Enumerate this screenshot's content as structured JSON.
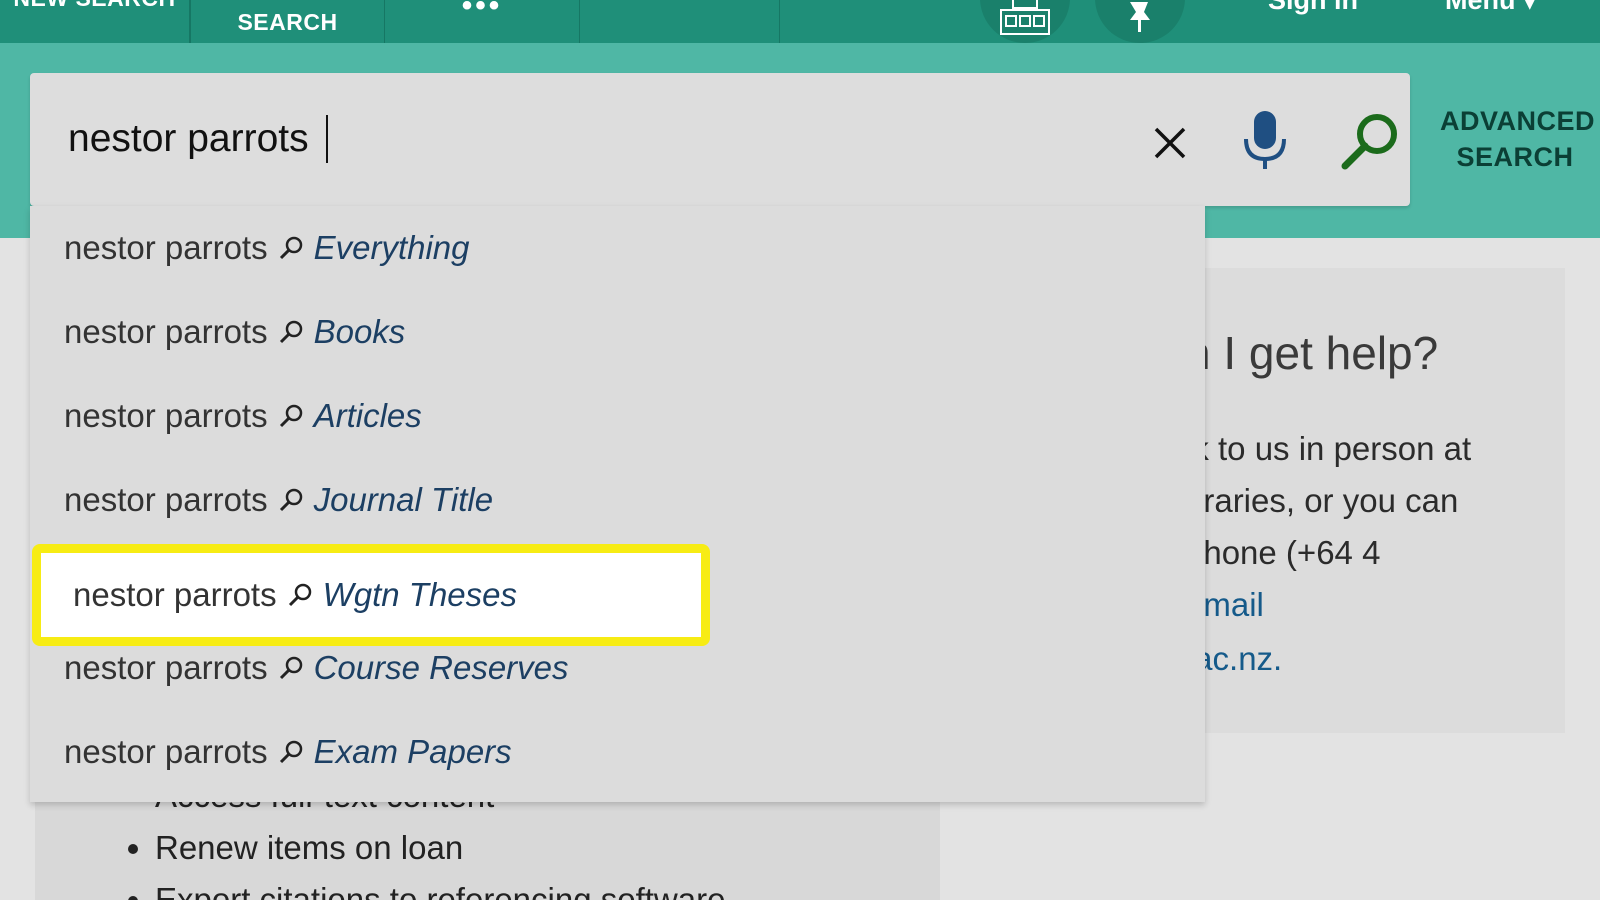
{
  "topbar": {
    "new_search": "NEW SEARCH",
    "advanced_search": "SEARCH",
    "more": "•••",
    "qr_icon": "qr-code-icon",
    "pin_icon": "pin-icon",
    "signin": "Sign in",
    "menu": "Menu"
  },
  "search": {
    "value": "nestor parrots",
    "clear_icon": "close-icon",
    "mic_icon": "microphone-icon",
    "go_icon": "search-icon",
    "advanced_line1": "ADVANCED",
    "advanced_line2": "SEARCH"
  },
  "suggestions": [
    {
      "query": "nestor parrots",
      "scope": "Everything"
    },
    {
      "query": "nestor parrots",
      "scope": "Books"
    },
    {
      "query": "nestor parrots",
      "scope": "Articles"
    },
    {
      "query": "nestor parrots",
      "scope": "Journal Title"
    },
    {
      "query": "nestor parrots",
      "scope": "Wgtn Theses"
    },
    {
      "query": "nestor parrots",
      "scope": "Course Reserves"
    },
    {
      "query": "nestor parrots",
      "scope": "Exam Papers"
    }
  ],
  "help": {
    "title": "n I get help?",
    "line1": "lk to us in person at",
    "line2": "oraries, or you can",
    "line3": "phone (+64 4",
    "line4": "email",
    "line5": ".ac.nz."
  },
  "left_list": {
    "item1": "Access full-text content",
    "item2": "Renew items on loan",
    "item3": "Export citations to referencing software"
  },
  "colors": {
    "topbar": "#1f8f79",
    "search_band": "#4fb7a5",
    "highlight": "#f7ec14",
    "scope_text": "#1c3f63",
    "go_icon": "#1b6b1b"
  }
}
